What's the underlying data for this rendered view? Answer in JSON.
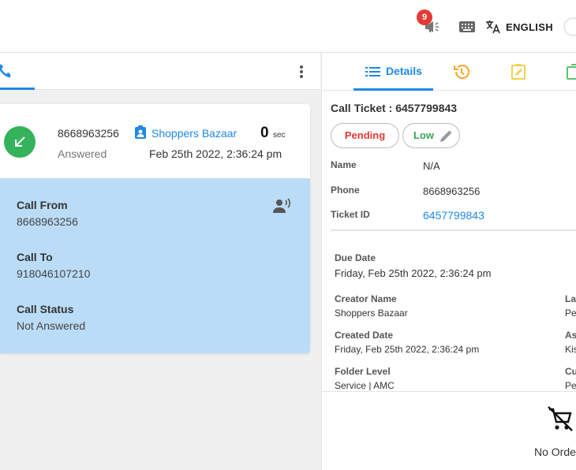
{
  "topbar": {
    "notification_count": "9",
    "language": "ENGLISH"
  },
  "call": {
    "phone_number": "8668963256",
    "status": "Answered",
    "contact_name": "Shoppers Bazaar",
    "duration": "0",
    "duration_unit": "sec",
    "datetime": "Feb 25th 2022, 2:36:24 pm",
    "details": {
      "call_from_label": "Call From",
      "call_from_value": "8668963256",
      "call_to_label": "Call To",
      "call_to_value": "918046107210",
      "call_status_label": "Call Status",
      "call_status_value": "Not Answered"
    }
  },
  "right": {
    "tabs": {
      "details_label": "Details"
    },
    "ticket_title": "Call Ticket : 6457799843",
    "chips": {
      "status": "Pending",
      "priority": "Low"
    },
    "fields": {
      "name_label": "Name",
      "name_value": "N/A",
      "phone_label": "Phone",
      "phone_value": "8668963256",
      "ticket_id_label": "Ticket ID",
      "ticket_id_value": "6457799843"
    },
    "details": {
      "due_date_label": "Due Date",
      "due_date_value": "Friday, Feb 25th 2022, 2:36:24 pm",
      "creator_name_label": "Creator Name",
      "creator_name_value": "Shoppers Bazaar",
      "created_date_label": "Created Date",
      "created_date_value": "Friday, Feb 25th 2022, 2:36:24 pm",
      "folder_level_label": "Folder Level",
      "folder_level_value": "Service | AMC",
      "right_col_labels": [
        "La",
        "As",
        "Cu"
      ],
      "right_col_values": [
        "Pe",
        "Kis",
        "Pe"
      ]
    },
    "orders": {
      "empty_text": "No Orders"
    }
  },
  "colors": {
    "accent": "#1e88e5",
    "answered_green": "#34b35a",
    "pending_red": "#e53935",
    "low_green": "#3aa35a",
    "call_detail_bg": "#bbdcf7"
  }
}
